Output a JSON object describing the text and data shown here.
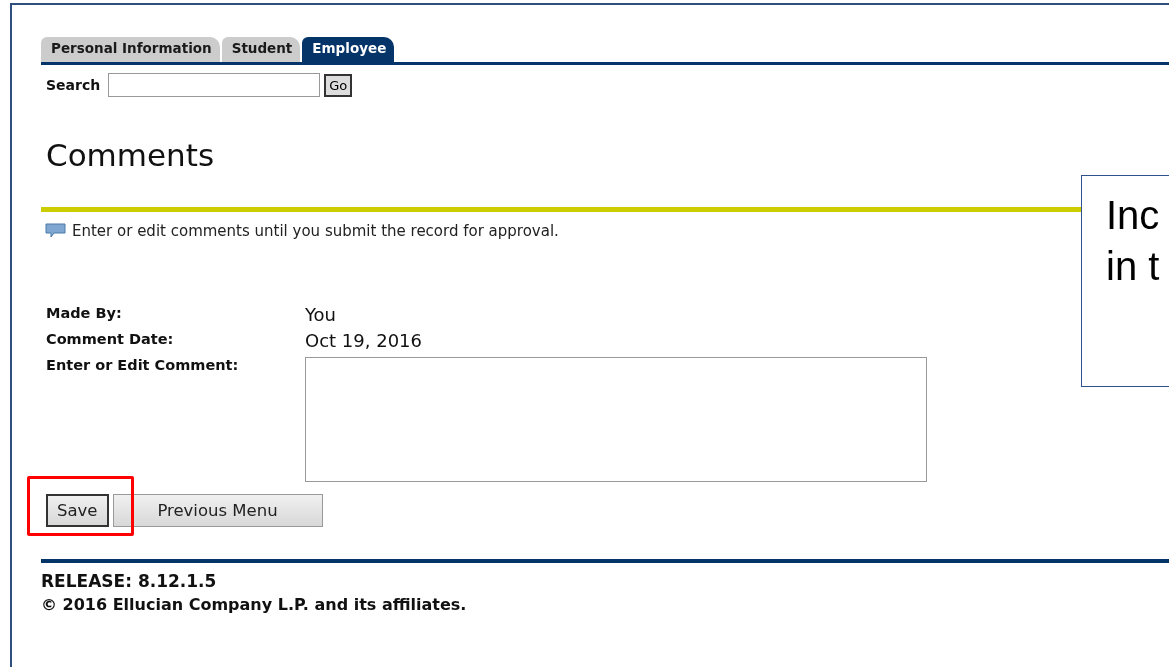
{
  "tabs": [
    {
      "label": "Personal Information",
      "selected": false
    },
    {
      "label": "Student",
      "selected": false
    },
    {
      "label": "Employee",
      "selected": true
    }
  ],
  "search": {
    "label": "Search",
    "button": "Go"
  },
  "heading": "Comments",
  "info_note": "Enter or edit comments until you submit the record for approval.",
  "fields": [
    {
      "label": "Made By:",
      "value": "You"
    },
    {
      "label": "Comment Date:",
      "value": "Oct 19, 2016"
    }
  ],
  "comment": {
    "label": "Enter or Edit Comment:"
  },
  "buttons": [
    {
      "label": "Save",
      "highlighted": true
    },
    {
      "label": "Previous Menu",
      "highlighted": false
    }
  ],
  "footer": {
    "release": "RELEASE: 8.12.1.5",
    "copyright": "© 2016 Ellucian Company L.P. and its affiliates."
  },
  "callout": {
    "lines": [
      "Inc",
      "in t"
    ]
  }
}
